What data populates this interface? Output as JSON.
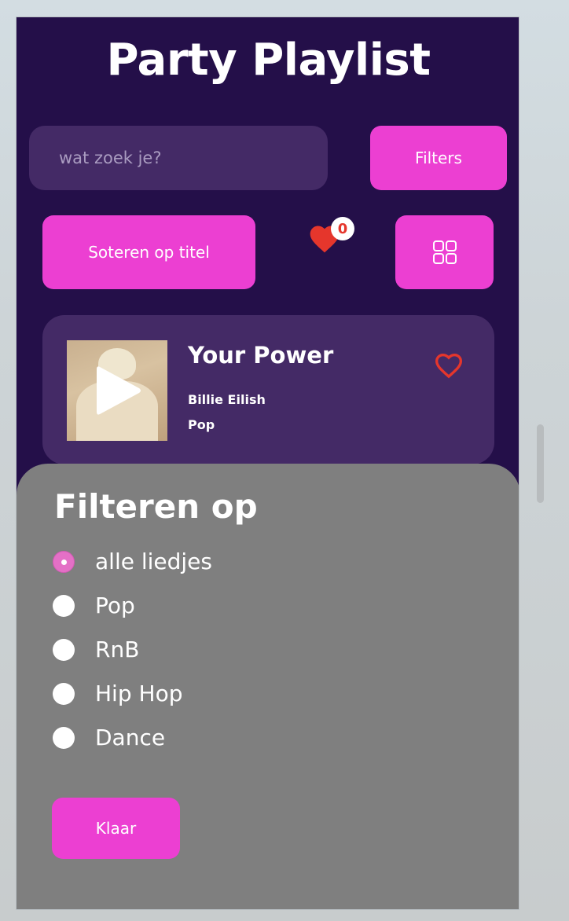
{
  "app": {
    "title": "Party Playlist"
  },
  "search": {
    "placeholder": "wat zoek je?"
  },
  "toolbar": {
    "filters_label": "Filters",
    "sort_label": "Soteren op titel",
    "favorites_count": "0",
    "grid_icon": "grid-icon"
  },
  "song": {
    "title": "Your Power",
    "artist": "Billie Eilish",
    "genre": "Pop",
    "liked": false
  },
  "filter_sheet": {
    "title": "Filteren op",
    "options": [
      {
        "label": "alle liedjes",
        "selected": true
      },
      {
        "label": "Pop",
        "selected": false
      },
      {
        "label": "RnB",
        "selected": false
      },
      {
        "label": "Hip Hop",
        "selected": false
      },
      {
        "label": "Dance",
        "selected": false
      }
    ],
    "done_label": "Klaar"
  },
  "colors": {
    "background": "#240f49",
    "surface": "#442a66",
    "accent": "#ec3fd2",
    "heart": "#e5362c",
    "sheet": "#7f7f7f"
  }
}
